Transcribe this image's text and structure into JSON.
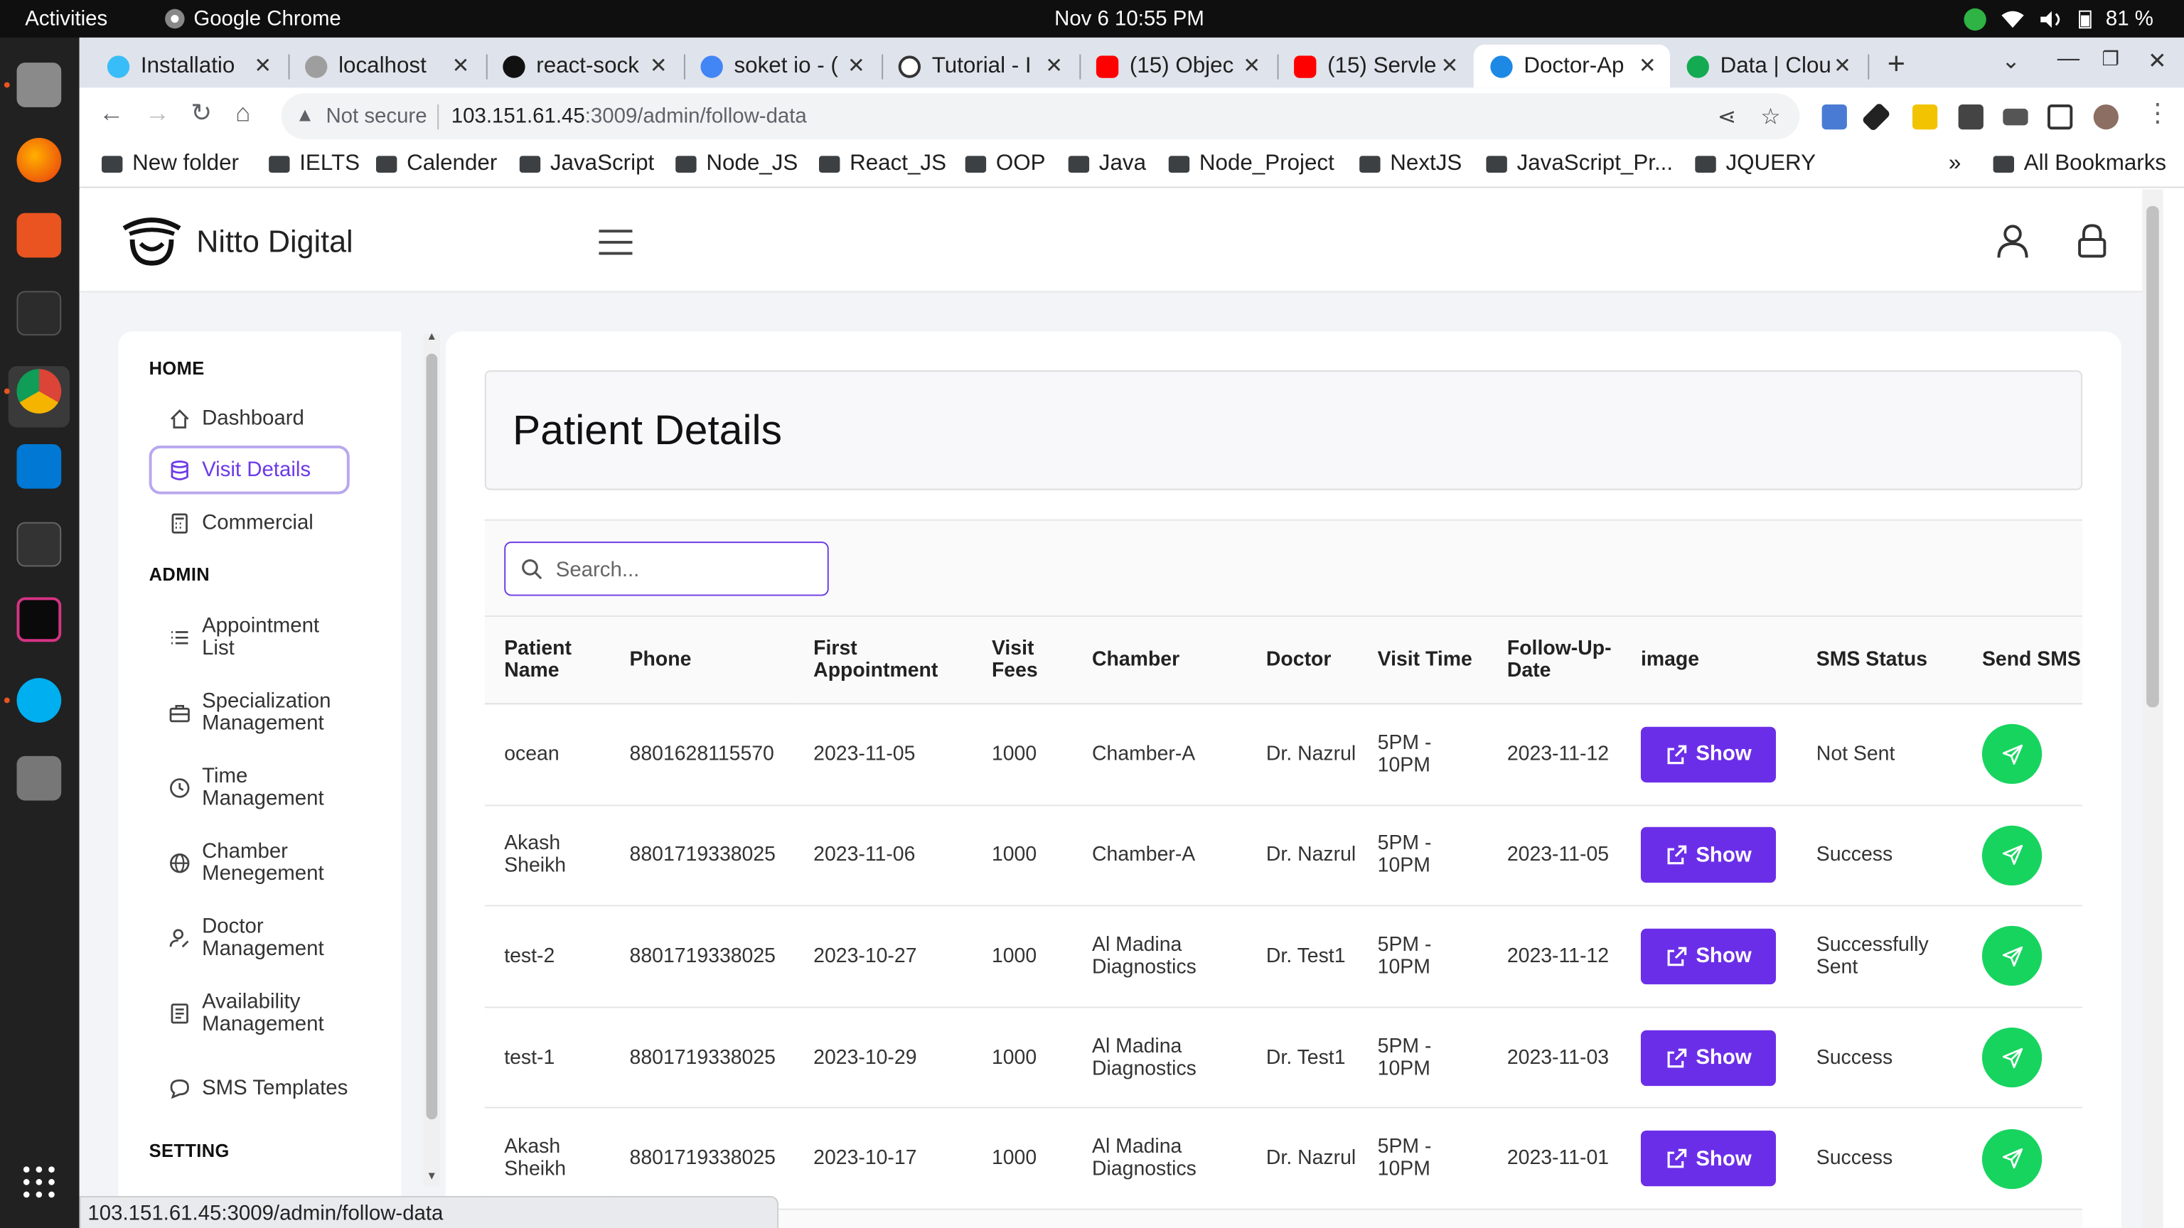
{
  "os": {
    "activities": "Activities",
    "app_name": "Google Chrome",
    "clock": "Nov 6  10:55 PM",
    "battery": "81 %"
  },
  "tabs": [
    {
      "label": "Installatio",
      "color": "#38bdf8"
    },
    {
      "label": "localhost",
      "color": "#9e9e9e"
    },
    {
      "label": "react-sock",
      "color": "#111111"
    },
    {
      "label": "soket io - (",
      "color": "#4285f4"
    },
    {
      "label": "Tutorial - I",
      "color": "#333333"
    },
    {
      "label": "(15) Objec",
      "color": "#ff0000"
    },
    {
      "label": "(15) Servle",
      "color": "#ff0000"
    },
    {
      "label": "Doctor-Ap",
      "color": "#1e88e5"
    },
    {
      "label": "Data | Clou",
      "color": "#13aa52"
    }
  ],
  "omnibox": {
    "security": "Not secure",
    "host": "103.151.61.45",
    "path": ":3009/admin/follow-data"
  },
  "bookmarks": [
    "New folder",
    "IELTS",
    "Calender",
    "JavaScript",
    "Node_JS",
    "React_JS",
    "OOP",
    "Java",
    "Node_Project",
    "NextJS",
    "JavaScript_Pr...",
    "JQUERY"
  ],
  "bookmarks_more": "»",
  "all_bookmarks": "All Bookmarks",
  "brand": "Nitto Digital",
  "sidebar": {
    "home_heading": "HOME",
    "admin_heading": "ADMIN",
    "setting_heading": "SETTING",
    "home_items": [
      "Dashboard",
      "Visit Details",
      "Commercial"
    ],
    "admin_items": [
      "Appointment List",
      "Specialization Management",
      "Time Management",
      "Chamber Menegement",
      "Doctor Management",
      "Availability Management",
      "SMS Templates"
    ]
  },
  "page_title": "Patient Details",
  "search_placeholder": "Search...",
  "table": {
    "headers": [
      "Patient Name",
      "Phone",
      "First Appointment",
      "Visit Fees",
      "Chamber",
      "Doctor",
      "Visit Time",
      "Follow-Up-Date",
      "image",
      "SMS Status",
      "Send SMS"
    ],
    "show_label": "Show",
    "rows": [
      {
        "name": "ocean",
        "phone": "8801628115570",
        "first": "2023-11-05",
        "fees": "1000",
        "chamber": "Chamber-A",
        "doctor": "Dr. Nazrul",
        "time": "5PM - 10PM",
        "followup": "2023-11-12",
        "sms": "Not Sent"
      },
      {
        "name": "Akash Sheikh",
        "phone": "8801719338025",
        "first": "2023-11-06",
        "fees": "1000",
        "chamber": "Chamber-A",
        "doctor": "Dr. Nazrul",
        "time": "5PM - 10PM",
        "followup": "2023-11-05",
        "sms": "Success"
      },
      {
        "name": "test-2",
        "phone": "8801719338025",
        "first": "2023-10-27",
        "fees": "1000",
        "chamber": "Al Madina Diagnostics",
        "doctor": "Dr. Test1",
        "time": "5PM - 10PM",
        "followup": "2023-11-12",
        "sms": "Successfully Sent"
      },
      {
        "name": "test-1",
        "phone": "8801719338025",
        "first": "2023-10-29",
        "fees": "1000",
        "chamber": "Al Madina Diagnostics",
        "doctor": "Dr. Test1",
        "time": "5PM - 10PM",
        "followup": "2023-11-03",
        "sms": "Success"
      },
      {
        "name": "Akash Sheikh",
        "phone": "8801719338025",
        "first": "2023-10-17",
        "fees": "1000",
        "chamber": "Al Madina Diagnostics",
        "doctor": "Dr. Nazrul",
        "time": "5PM - 10PM",
        "followup": "2023-11-01",
        "sms": "Success"
      }
    ]
  },
  "status_url": "103.151.61.45:3009/admin/follow-data",
  "colors": {
    "accent": "#6b2ee8",
    "send": "#17d45f"
  }
}
